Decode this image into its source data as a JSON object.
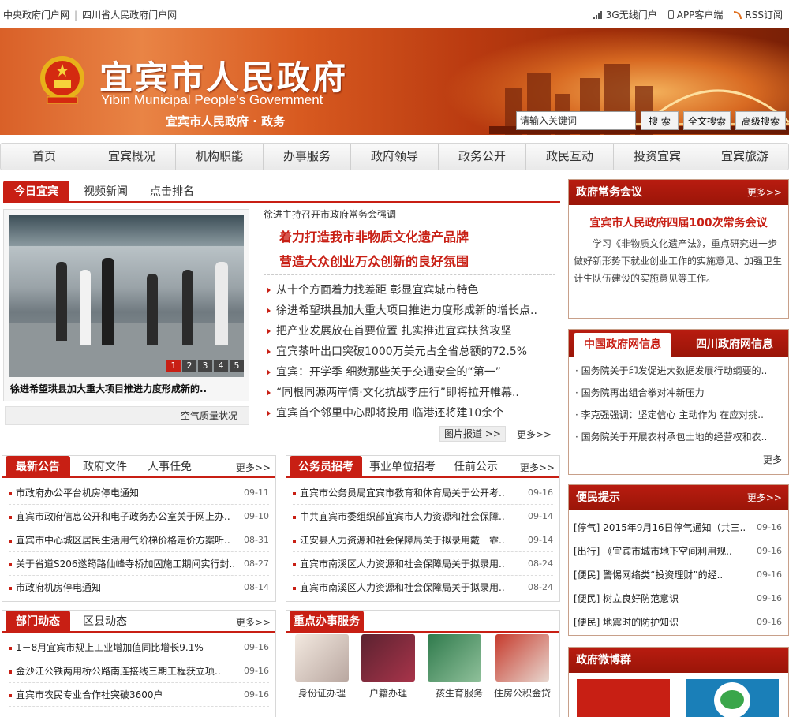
{
  "topbar": {
    "links": [
      "中央政府门户网",
      "四川省人民政府门户网"
    ],
    "right": [
      "3G无线门户",
      "APP客户端",
      "RSS订阅"
    ]
  },
  "banner": {
    "title_cn": "宜宾市人民政府",
    "title_en": "Yibin Municipal People's Government",
    "subtitle": "宜宾市人民政府 · 政务"
  },
  "search": {
    "value": "请输入关键词",
    "btn_search": "搜 索",
    "btn_full": "全文搜索",
    "btn_adv": "高级搜索"
  },
  "nav": [
    "首页",
    "宜宾概况",
    "机构职能",
    "办事服务",
    "政府领导",
    "政务公开",
    "政民互动",
    "投资宜宾",
    "宜宾旅游"
  ],
  "today": {
    "tabs": [
      "今日宜宾",
      "视频新闻",
      "点击排名"
    ],
    "photo_caption": "徐进希望珙县加大重大项目推进力度形成新的..",
    "pager": [
      "1",
      "2",
      "3",
      "4",
      "5"
    ],
    "air": "空气质量状况",
    "top_small": "徐进主持召开市政府常务会强调",
    "headline1": "着力打造我市非物质文化遗产品牌",
    "headline2": "营造大众创业万众创新的良好氛围",
    "items": [
      "从十个方面着力找差距 彰显宜宾城市特色",
      "徐进希望珙县加大重大项目推进力度形成新的增长点..",
      "把产业发展放在首要位置 扎实推进宜宾扶贫攻坚",
      "宜宾茶叶出口突破1000万美元占全省总额的72.5%",
      "宜宾：开学季 细数那些关于交通安全的“第一”",
      "“同根同源两岸情·文化抗战李庄行”即将拉开帷幕..",
      "宜宾首个邻里中心即将投用 临港还将建10余个"
    ],
    "photo_report": "图片报道 >>",
    "more": "更多>>"
  },
  "meeting": {
    "title": "政府常务会议",
    "more": "更多>>",
    "headline": "宜宾市人民政府四届100次常务会议",
    "text": "学习《非物质文化遗产法》，重点研究进一步做好新形势下就业创业工作的实施意见、加强卫生计生队伍建设的实施意见等工作。"
  },
  "govnet": {
    "tabs": [
      "中国政府网信息",
      "四川政府网信息"
    ],
    "items": [
      "国务院关于印发促进大数据发展行动纲要的..",
      "国务院再出组合拳对冲新压力",
      "李克强强调：坚定信心 主动作为 在应对挑..",
      "国务院关于开展农村承包土地的经营权和农.."
    ],
    "more": "更多"
  },
  "notice": {
    "tabs": [
      "最新公告",
      "政府文件",
      "人事任免"
    ],
    "more": "更多>>",
    "rows": [
      {
        "t": "市政府办公平台机房停电通知",
        "d": "09-11"
      },
      {
        "t": "宜宾市政府信息公开和电子政务办公室关于网上办..",
        "d": "09-10"
      },
      {
        "t": "宜宾市中心城区居民生活用气阶梯价格定价方案听..",
        "d": "08-31"
      },
      {
        "t": "关于省道S206遂筠路仙峰寺桥加固施工期间实行封..",
        "d": "08-27"
      },
      {
        "t": "市政府机房停电通知",
        "d": "08-14"
      }
    ]
  },
  "recruit": {
    "tabs": [
      "公务员招考",
      "事业单位招考",
      "任前公示"
    ],
    "more": "更多>>",
    "rows": [
      {
        "t": "宜宾市公务员局宜宾市教育和体育局关于公开考..",
        "d": "09-16"
      },
      {
        "t": "中共宜宾市委组织部宜宾市人力资源和社会保障..",
        "d": "09-14"
      },
      {
        "t": "江安县人力资源和社会保障局关于拟录用戴一霏..",
        "d": "09-14"
      },
      {
        "t": "宜宾市南溪区人力资源和社会保障局关于拟录用..",
        "d": "08-24"
      },
      {
        "t": "宜宾市南溪区人力资源和社会保障局关于拟录用..",
        "d": "08-24"
      }
    ]
  },
  "convenience": {
    "title": "便民提示",
    "more": "更多>>",
    "rows": [
      {
        "t": "[停气]  2015年9月16日停气通知（共三..",
        "d": "09-16"
      },
      {
        "t": "[出行]  《宜宾市城市地下空间利用规..",
        "d": "09-16"
      },
      {
        "t": "[便民]  警惕网络类“投资理财”的经..",
        "d": "09-16"
      },
      {
        "t": "[便民]  树立良好防范意识",
        "d": "09-16"
      },
      {
        "t": "[便民]  地震时的防护知识",
        "d": "09-16"
      }
    ]
  },
  "dept": {
    "tabs": [
      "部门动态",
      "区县动态"
    ],
    "more": "更多>>",
    "rows": [
      {
        "t": "1－8月宜宾市规上工业增加值同比增长9.1%",
        "d": "09-16"
      },
      {
        "t": "金沙江公铁两用桥公路南连接线三期工程获立项..",
        "d": "09-16"
      },
      {
        "t": "宜宾市农民专业合作社突破3600户",
        "d": "09-16"
      }
    ]
  },
  "services": {
    "title": "重点办事服务",
    "items": [
      "身份证办理",
      "户籍办理",
      "一孩生育服务",
      "住房公积金贷"
    ]
  },
  "weibo": {
    "title": "政府微博群"
  }
}
